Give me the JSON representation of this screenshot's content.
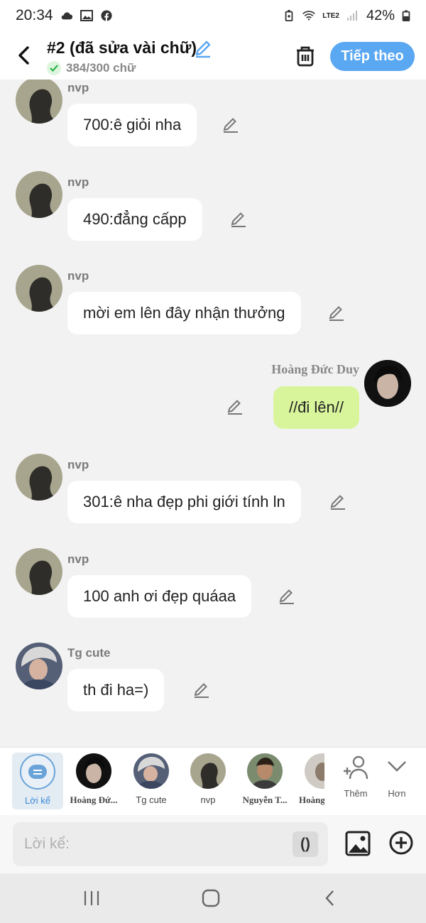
{
  "status_bar": {
    "time": "20:34",
    "battery": "42%",
    "network": "LTE2"
  },
  "header": {
    "title": "#2 (đã sửa vài chữ)",
    "char_count": "384/300 chữ",
    "next_label": "Tiếp theo"
  },
  "messages": [
    {
      "sender": "nvp",
      "text": "700:ê giỏi nha",
      "side": "left"
    },
    {
      "sender": "nvp",
      "text": "490:đẳng cấpp",
      "side": "left"
    },
    {
      "sender": "nvp",
      "text": "mời em lên đây nhận thưởng",
      "side": "left"
    },
    {
      "sender": "Hoàng Đức Duy",
      "text": "//đi lên//",
      "side": "right"
    },
    {
      "sender": "nvp",
      "text": "301:ê nha đẹp phi giới tính ln",
      "side": "left"
    },
    {
      "sender": "nvp",
      "text": "100 anh ơi đẹp quáaa",
      "side": "left"
    },
    {
      "sender": "Tg cute",
      "text": "th đi  ha=)",
      "side": "left"
    }
  ],
  "characters": [
    {
      "label": "Lời kể",
      "selected": true
    },
    {
      "label": "Hoàng Đứ..."
    },
    {
      "label": "Tg cute"
    },
    {
      "label": "nvp"
    },
    {
      "label": "Nguyễn T..."
    },
    {
      "label": "Hoàng"
    }
  ],
  "tools": {
    "add_label": "Thêm",
    "more_label": "Hơn"
  },
  "input": {
    "placeholder": "Lời kể:",
    "paren_label": "()"
  },
  "colors": {
    "accent": "#5aa7f2",
    "right_bubble": "#d9f59c",
    "left_bubble": "#ffffff",
    "background": "#f2f2f2"
  }
}
